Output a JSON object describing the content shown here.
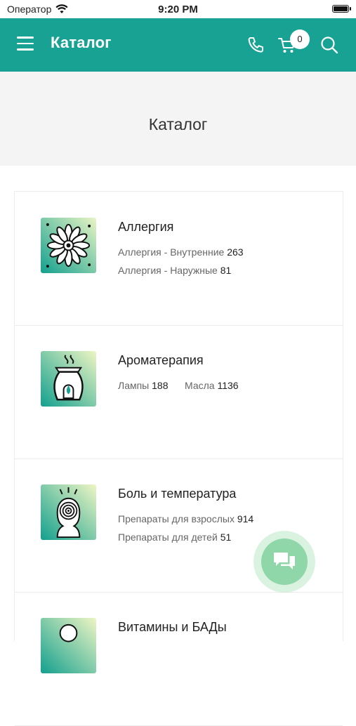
{
  "status_bar": {
    "carrier": "Оператор",
    "time": "9:20 PM"
  },
  "header": {
    "title": "Каталог",
    "cart_count": "0"
  },
  "page": {
    "title": "Каталог"
  },
  "categories": [
    {
      "name": "Аллергия",
      "icon": "flower-icon",
      "subcategories": [
        {
          "label": "Аллергия - Внутренние",
          "count": "263"
        },
        {
          "label": "Аллергия - Наружные",
          "count": "81"
        }
      ]
    },
    {
      "name": "Ароматерапия",
      "icon": "aroma-lamp-icon",
      "subcategories": [
        {
          "label": "Лампы",
          "count": "188"
        },
        {
          "label": "Масла",
          "count": "1136"
        }
      ]
    },
    {
      "name": "Боль и температура",
      "icon": "head-pain-icon",
      "subcategories": [
        {
          "label": "Препараты для взрослых",
          "count": "914"
        },
        {
          "label": "Препараты для детей",
          "count": "51"
        }
      ]
    },
    {
      "name": "Витамины и БАДы",
      "icon": "vitamins-icon",
      "subcategories": []
    }
  ],
  "colors": {
    "header_bg": "#17a293",
    "fab": "#8fd6a8"
  }
}
